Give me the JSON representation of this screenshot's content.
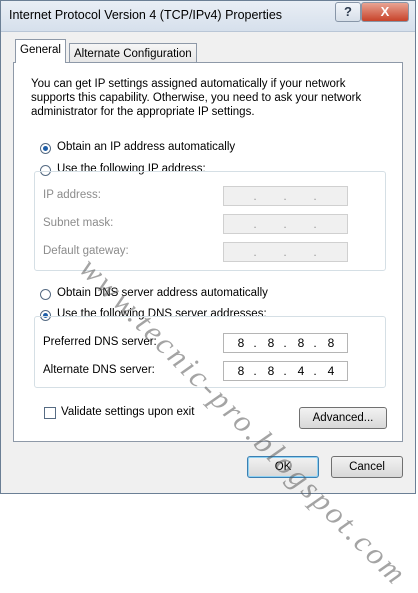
{
  "window": {
    "title": "Internet Protocol Version 4 (TCP/IPv4) Properties",
    "help_glyph": "?",
    "close_glyph": "X"
  },
  "tabs": [
    {
      "label": "General",
      "selected": true
    },
    {
      "label": "Alternate Configuration",
      "selected": false
    }
  ],
  "general": {
    "description": "You can get IP settings assigned automatically if your network supports this capability. Otherwise, you need to ask your network administrator for the appropriate IP settings.",
    "ip_mode": {
      "auto_label": "Obtain an IP address automatically",
      "manual_label": "Use the following IP address:",
      "selected": "auto"
    },
    "ip_fields": [
      {
        "label": "IP address:",
        "octets": [
          "",
          "",
          "",
          ""
        ],
        "enabled": false
      },
      {
        "label": "Subnet mask:",
        "octets": [
          "",
          "",
          "",
          ""
        ],
        "enabled": false
      },
      {
        "label": "Default gateway:",
        "octets": [
          "",
          "",
          "",
          ""
        ],
        "enabled": false
      }
    ],
    "dns_mode": {
      "auto_label": "Obtain DNS server address automatically",
      "manual_label": "Use the following DNS server addresses:",
      "selected": "manual"
    },
    "dns_fields": [
      {
        "label": "Preferred DNS server:",
        "octets": [
          "8",
          "8",
          "8",
          "8"
        ],
        "enabled": true
      },
      {
        "label": "Alternate DNS server:",
        "octets": [
          "8",
          "8",
          "4",
          "4"
        ],
        "enabled": true
      }
    ],
    "validate_label": "Validate settings upon exit",
    "validate_checked": false,
    "advanced_label": "Advanced..."
  },
  "footer": {
    "ok_label": "OK",
    "cancel_label": "Cancel"
  },
  "watermark": "www.tecnic-pro.blogspot.com",
  "colors": {
    "selected_radio": "#1e5ea8",
    "close_button": "#c8432a",
    "dialog_background": "#f0f0f0"
  }
}
